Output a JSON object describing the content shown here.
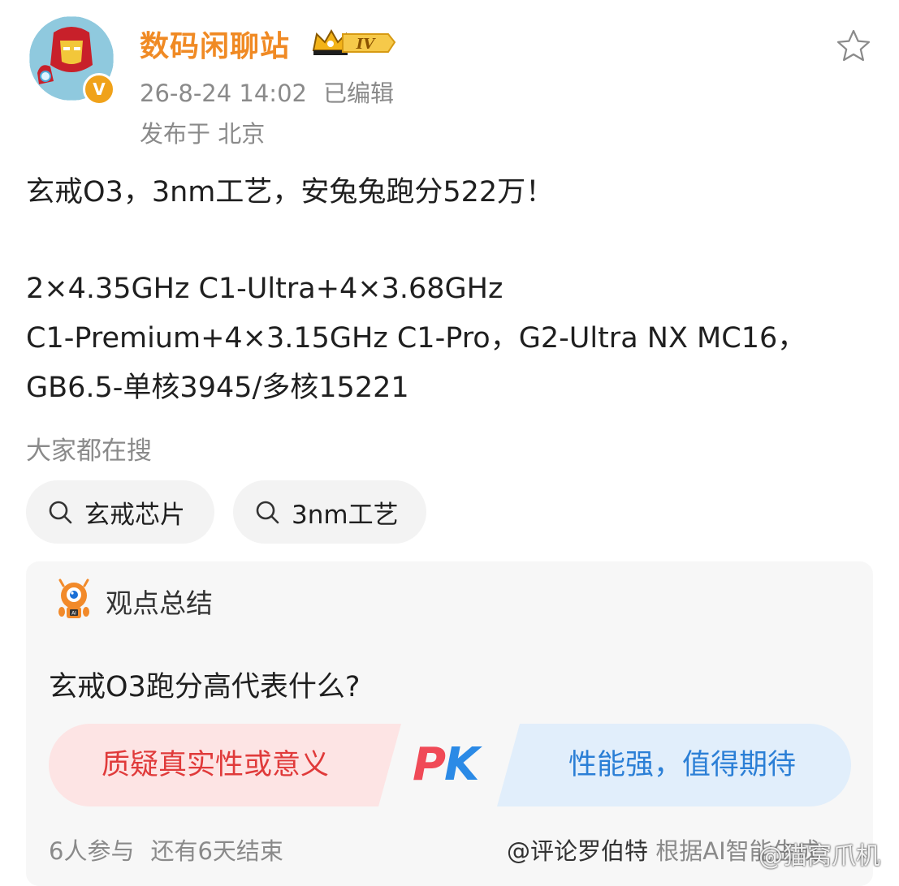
{
  "header": {
    "username": "数码闲聊站",
    "rank_badge": "IV",
    "verified_badge": "V",
    "timestamp": "26-8-24 14:02",
    "edited": "已编辑",
    "location": "发布于 北京"
  },
  "post": {
    "title": "玄戒O3，3nm工艺，安兔兔跑分522万！",
    "spec_lines": [
      "2×4.35GHz C1-Ultra+4×3.68GHz",
      "C1-Premium+4×3.15GHz C1-Pro，G2-Ultra NX MC16，",
      "GB6.5-单核3945/多核15221"
    ]
  },
  "search": {
    "label": "大家都在搜",
    "chips": [
      "玄戒芯片",
      "3nm工艺"
    ]
  },
  "summary_card": {
    "title": "观点总结",
    "question": "玄戒O3跑分高代表什么?",
    "option_left": "质疑真实性或意义",
    "option_right": "性能强，值得期待",
    "pk_p": "P",
    "pk_k": "K",
    "participants": "6人参与",
    "remaining": "还有6天结束",
    "source_mention": "@评论罗伯特",
    "source_note": " 根据AI智能生成"
  },
  "watermark": "@猫窝爪机",
  "colors": {
    "username": "#f08a24",
    "option_left_bg": "#fde4e4",
    "option_left_text": "#e03a3a",
    "option_right_bg": "#e1eefb",
    "option_right_text": "#2b7fd6",
    "pk_p": "#f04a57",
    "pk_k": "#2b8ae6"
  },
  "icons": [
    "star-icon",
    "search-icon",
    "robot-icon",
    "crown-icon",
    "verified-icon"
  ]
}
